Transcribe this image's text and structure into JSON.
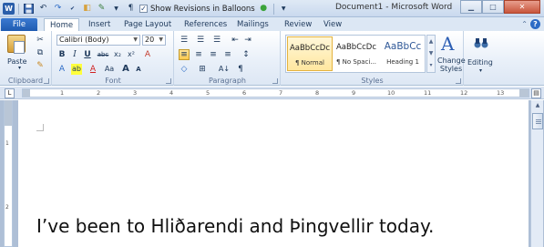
{
  "window": {
    "title": "Document1 - Microsoft Word",
    "show_revisions_label": "Show Revisions in Balloons",
    "min_symbol": "▁",
    "max_symbol": "□",
    "close_symbol": "✕"
  },
  "qat": {
    "word_icon": "W",
    "save_icon": "save-icon",
    "undo_icon": "↶",
    "redo_icon": "↷",
    "spell_icon": "ABC",
    "check_mark": "✓"
  },
  "tabs": {
    "file": "File",
    "items": [
      "Home",
      "Insert",
      "Page Layout",
      "References",
      "Mailings",
      "Review",
      "View"
    ],
    "help": "?",
    "minimize_ribbon": "⌃"
  },
  "clipboard": {
    "paste_label": "Paste",
    "group_label": "Clipboard"
  },
  "font": {
    "font_name": "Calibri (Body)",
    "font_size": "20",
    "grow": "A",
    "shrink": "A",
    "change_case": "Aa",
    "clear": "A",
    "bold": "B",
    "italic": "I",
    "underline": "U",
    "strike": "abc",
    "subscript": "x₂",
    "superscript": "x²",
    "text_effects": "A",
    "highlight": "ab",
    "font_color": "A",
    "group_label": "Font"
  },
  "paragraph": {
    "bullets": "☰",
    "numbering": "☰",
    "multilevel": "☰",
    "decrease_indent": "⇤",
    "increase_indent": "⇥",
    "align_left": "≡",
    "center": "≡",
    "align_right": "≡",
    "justify": "≡",
    "line_spacing": "↕",
    "shading": "◇",
    "borders": "⊞",
    "sort": "A↓",
    "show_marks": "¶",
    "group_label": "Paragraph"
  },
  "styles": {
    "items": [
      {
        "preview": "AaBbCcDc",
        "name": "¶ Normal",
        "selected": true
      },
      {
        "preview": "AaBbCcDc",
        "name": "¶ No Spaci...",
        "selected": false
      },
      {
        "preview": "AaBbCc",
        "name": "Heading 1",
        "selected": false
      }
    ],
    "change_styles": "Change Styles",
    "change_styles_line1": "Change",
    "change_styles_line2": "Styles",
    "group_label": "Styles"
  },
  "editing": {
    "label": "Editing"
  },
  "ruler": {
    "tab_stop": "L",
    "numbers": [
      "1",
      "2",
      "3",
      "4",
      "5",
      "6",
      "7",
      "8",
      "9",
      "10",
      "11",
      "12",
      "13"
    ],
    "vertical_numbers": [
      "1",
      "2"
    ]
  },
  "document": {
    "text": "I’ve been to Hliðarendi and Þingvellir today."
  },
  "colors": {
    "accent": "#2a5eaa",
    "file_tab": "#1f5bb1",
    "selected_style": "#ffe7a0",
    "workspace": "#aebfd6"
  }
}
